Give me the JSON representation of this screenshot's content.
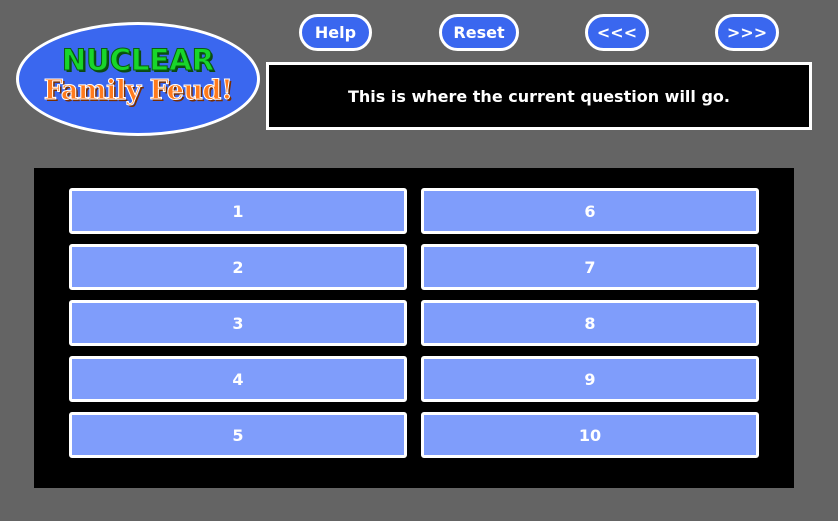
{
  "logo": {
    "line1": "NUCLEAR",
    "line2": "Family Feud!"
  },
  "toolbar": {
    "help_label": "Help",
    "reset_label": "Reset",
    "prev_label": "<<<",
    "next_label": ">>>"
  },
  "question": {
    "text": "This is where the current question will go."
  },
  "answers": [
    "1",
    "2",
    "3",
    "4",
    "5",
    "6",
    "7",
    "8",
    "9",
    "10"
  ],
  "colors": {
    "background": "#646464",
    "accent_blue": "#3a67ef",
    "answer_tile": "#7f9dfb",
    "logo_green": "#18d62a",
    "logo_orange": "#ff7a1c",
    "board": "#000000"
  }
}
